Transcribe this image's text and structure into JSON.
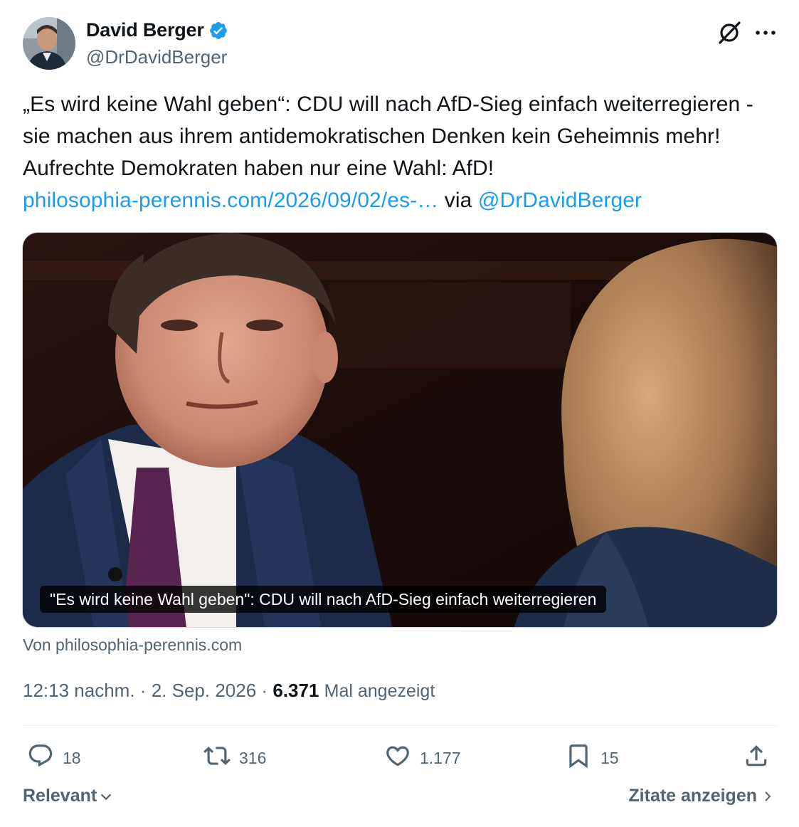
{
  "author": {
    "display_name": "David Berger",
    "handle": "@DrDavidBerger",
    "verified": true
  },
  "tweet": {
    "text_before_link": "„Es wird keine Wahl geben“: CDU will nach AfD-Sieg einfach weiterregieren - sie machen aus ihrem antidemokratischen Denken kein Geheimnis mehr! Aufrechte Demokraten haben nur eine Wahl: AfD!",
    "link_text": "philosophia-perennis.com/2026/09/02/es-…",
    "via_text": "via",
    "mention": "@DrDavidBerger"
  },
  "card": {
    "caption": "\"Es wird keine Wahl geben\": CDU will nach AfD-Sieg einfach weiterregieren",
    "source": "Von philosophia-perennis.com"
  },
  "meta": {
    "time": "12:13 nachm.",
    "date": "2. Sep. 2026",
    "separator": "·",
    "views_count": "6.371",
    "views_label": "Mal angezeigt"
  },
  "actions": {
    "replies": "18",
    "reposts": "316",
    "likes": "1.177",
    "bookmarks": "15"
  },
  "footer": {
    "sort_label": "Relevant",
    "quotes_label": "Zitate anzeigen"
  },
  "colors": {
    "link": "#1d9bf0",
    "secondary_text": "#536471",
    "primary_text": "#0f1419",
    "verified_badge": "#1d9bf0"
  },
  "icons": [
    "grok-icon",
    "more-icon",
    "verified-icon",
    "reply-icon",
    "repost-icon",
    "like-icon",
    "bookmark-icon",
    "share-icon",
    "chevron-down-icon",
    "chevron-right-icon"
  ]
}
